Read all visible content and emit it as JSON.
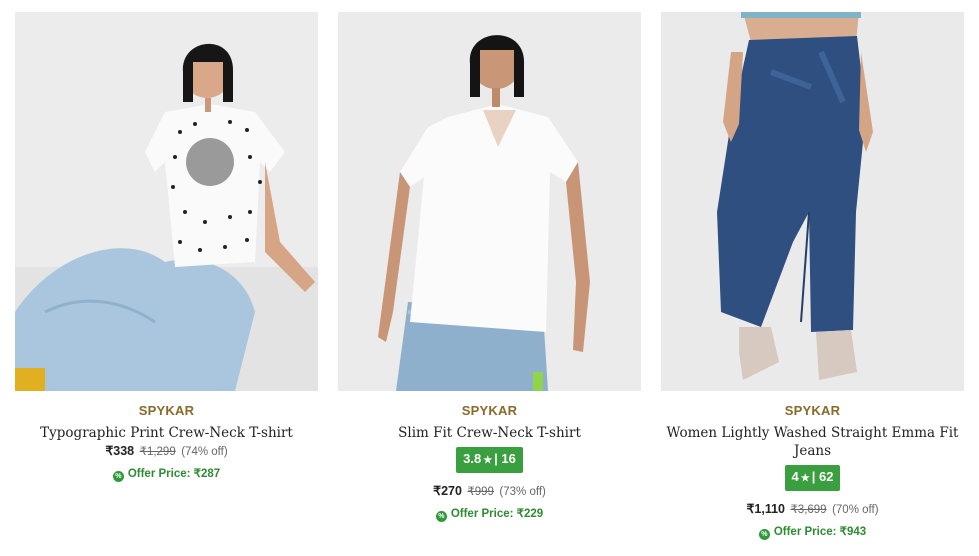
{
  "products": [
    {
      "brand": "SPYKAR",
      "title": "Typographic Print Crew-Neck T-shirt",
      "price": "₹338",
      "mrp": "₹1,299",
      "discount": "(74% off)",
      "offer_label": "Offer Price: ₹287"
    },
    {
      "brand": "SPYKAR",
      "title": "Slim Fit Crew-Neck T-shirt",
      "rating": "3.8",
      "rating_star": "★",
      "rating_sep": "|",
      "rating_count": "16",
      "price": "₹270",
      "mrp": "₹999",
      "discount": "(73% off)",
      "offer_label": "Offer Price: ₹229"
    },
    {
      "brand": "SPYKAR",
      "title": "Women Lightly Washed Straight Emma Fit Jeans",
      "rating": "4",
      "rating_star": "★",
      "rating_sep": "|",
      "rating_count": "62",
      "price": "₹1,110",
      "mrp": "₹3,699",
      "discount": "(70% off)",
      "offer_label": "Offer Price: ₹943"
    }
  ],
  "icons": {
    "offer_icon": "percent-tag-icon",
    "rating_star_icon": "star-icon"
  },
  "colors": {
    "brand_text": "#8a6a2a",
    "offer_green": "#2e8b32",
    "rating_green": "#3a9f3e"
  }
}
